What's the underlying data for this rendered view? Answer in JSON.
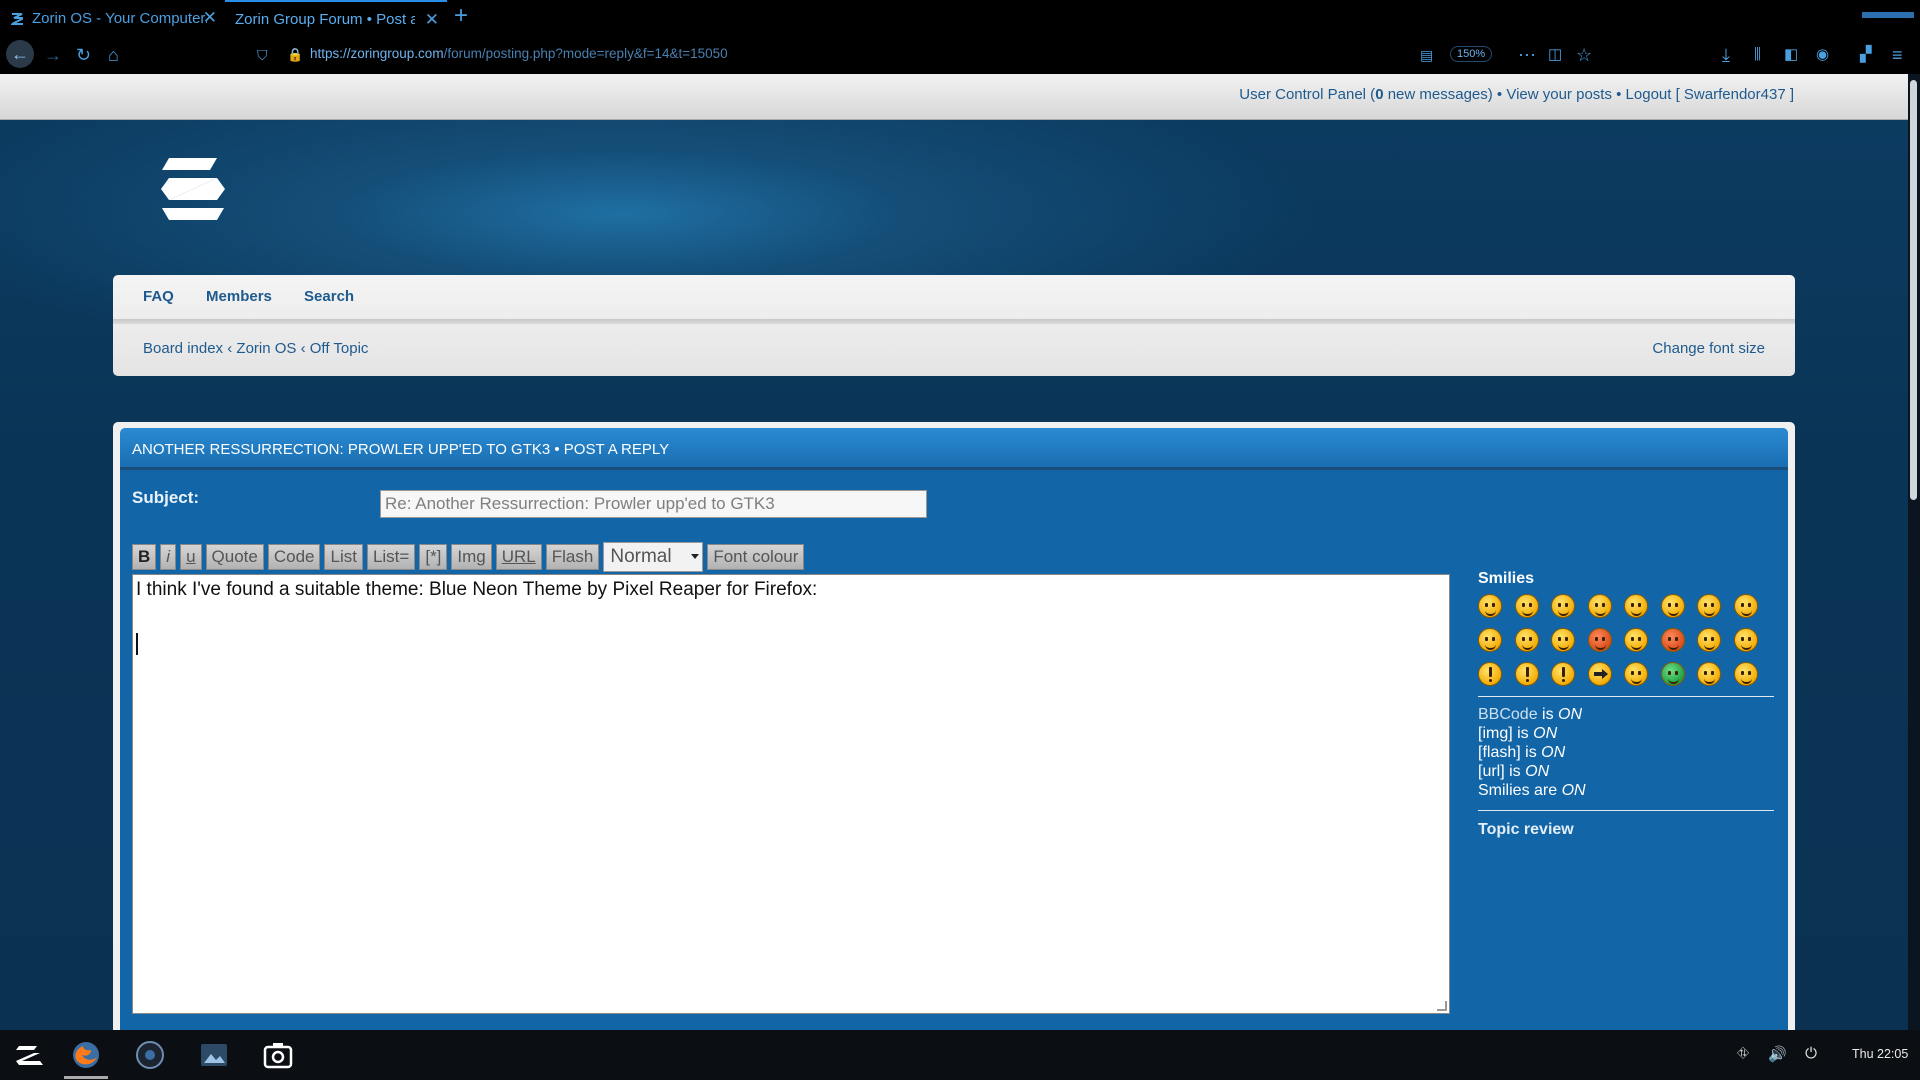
{
  "browser": {
    "tabs": [
      {
        "title": "Zorin OS - Your Computer. Better.",
        "active": false
      },
      {
        "title": "Zorin Group Forum • Post a reply",
        "active": true
      }
    ],
    "url_domain": "https://zoringroup.com",
    "url_path": "/forum/posting.php?mode=reply&f=14&t=15050",
    "zoom": "150%"
  },
  "forum": {
    "userbar": {
      "ucp": "User Control Panel",
      "ucp_open": " (",
      "new_count": "0",
      "new_label": " new messages)",
      "sep": " • ",
      "view_posts": "View your posts",
      "logout": "Logout [ Swarfendor437 ]"
    },
    "nav": {
      "faq": "FAQ",
      "members": "Members",
      "search": "Search"
    },
    "breadcrumb": {
      "board_index": "Board index",
      "sep": " ‹ ",
      "zorin_os": "Zorin OS",
      "off_topic": "Off Topic"
    },
    "change_font_size": "Change font size",
    "post": {
      "header_title": "ANOTHER RESSURRECTION: PROWLER UPP'ED TO GTK3 • POST A REPLY",
      "subject_label": "Subject:",
      "subject_value": "Re: Another Ressurrection: Prowler upp'ed to GTK3",
      "toolbar": {
        "bold": "B",
        "italic": "i",
        "underline": "u",
        "quote": "Quote",
        "code": "Code",
        "list": "List",
        "list_eq": "List=",
        "list_item": "[*]",
        "img": "Img",
        "url": "URL",
        "flash": "Flash",
        "font_size": "Normal",
        "font_colour": "Font colour"
      },
      "message_text": "I think I've found a suitable theme: Blue Neon Theme by Pixel Reaper for Firefox:"
    },
    "sidebar": {
      "smilies_title": "Smilies",
      "smilies": [
        "laughing-smiley-icon",
        "grinning-smiley-icon",
        "winking-smiley-icon",
        "cheeky-smiley-icon",
        "surprised-smiley-icon",
        "shocked-smiley-icon",
        "confused-smiley-icon",
        "cool-smiley-icon",
        "happy-smiley-icon",
        "mad-smiley-icon",
        "tongue-smiley-icon",
        "red-face-smiley-icon",
        "crying-smiley-icon",
        "evil-smiley-icon",
        "twisted-smiley-icon",
        "rolleyes-smiley-icon",
        "exclamation-icon",
        "question-icon",
        "idea-icon",
        "arrow-icon",
        "neutral-smiley-icon",
        "green-monster-icon",
        "geek-smiley-icon",
        "uber-geek-smiley-icon"
      ],
      "bbcode_status": [
        {
          "label": "BBCode",
          "mid": " is ",
          "state": "ON"
        },
        {
          "label": "[img]",
          "mid": " is ",
          "state": "ON"
        },
        {
          "label": "[flash]",
          "mid": " is ",
          "state": "ON"
        },
        {
          "label": "[url]",
          "mid": " is ",
          "state": "ON"
        },
        {
          "label": "Smilies",
          "mid": " are ",
          "state": "ON"
        }
      ],
      "topic_review": "Topic review"
    }
  },
  "taskbar": {
    "clock": "Thu 22:05",
    "apps": [
      "zorin-menu-icon",
      "firefox-icon",
      "disk-icon",
      "image-viewer-icon",
      "screenshot-icon"
    ]
  }
}
